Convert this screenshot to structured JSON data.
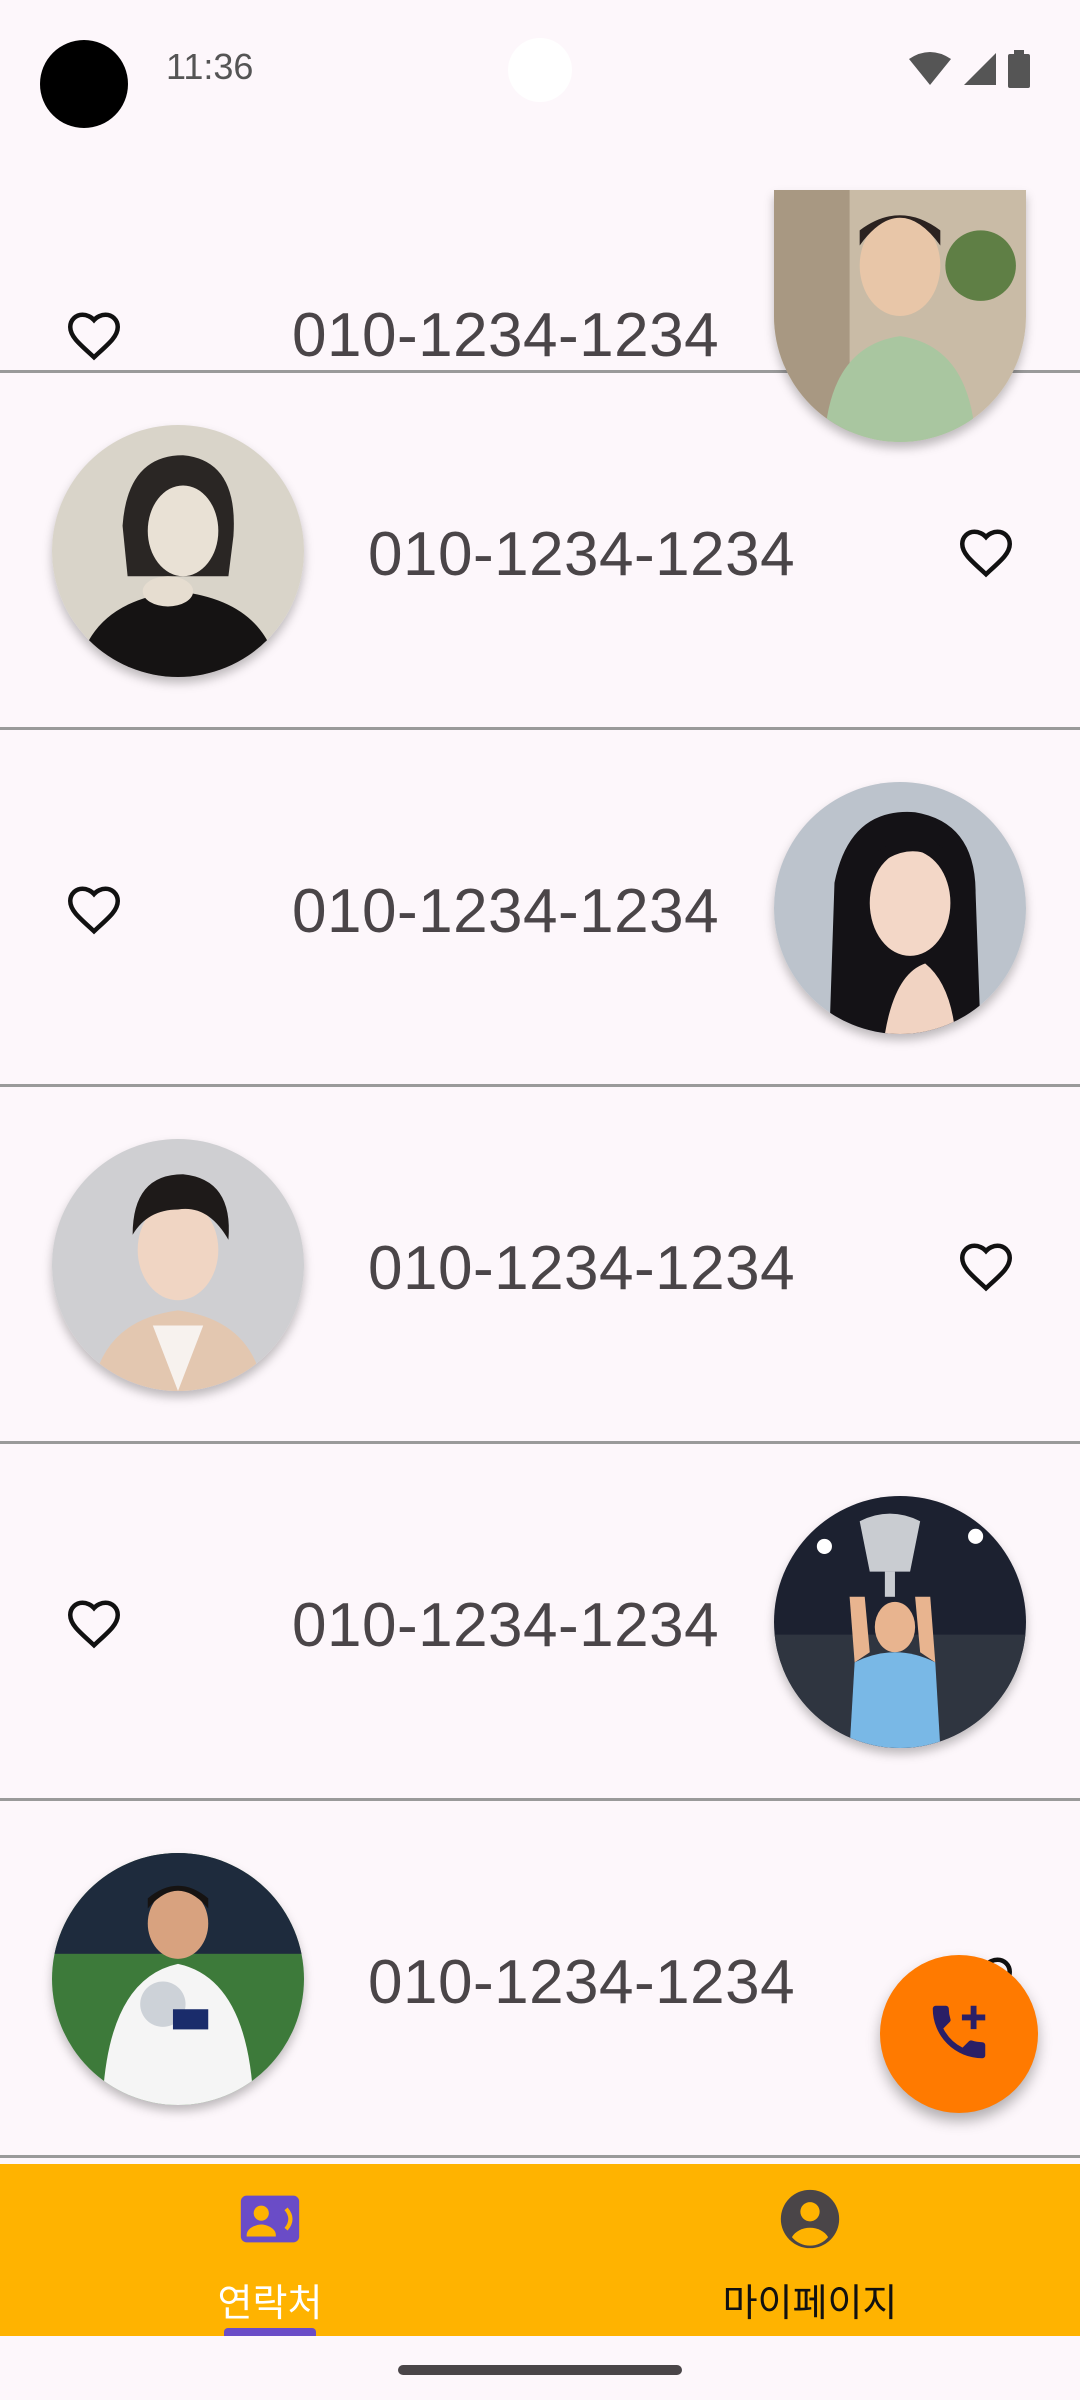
{
  "status_bar": {
    "time": "11:36"
  },
  "contacts": [
    {
      "phone": "010-1234-1234",
      "favorite": false,
      "avatar": "man-green-shirt-photo"
    },
    {
      "phone": "010-1234-1234",
      "favorite": false,
      "avatar": "woman-black-turtleneck-photo"
    },
    {
      "phone": "010-1234-1234",
      "favorite": false,
      "avatar": "woman-long-black-hair-photo"
    },
    {
      "phone": "010-1234-1234",
      "favorite": false,
      "avatar": "man-portrait-photo"
    },
    {
      "phone": "010-1234-1234",
      "favorite": false,
      "avatar": "player-holding-trophy-photo"
    },
    {
      "phone": "010-1234-1234",
      "favorite": false,
      "avatar": "player-with-award-photo"
    }
  ],
  "fab": {
    "icon": "add-call-icon"
  },
  "bottom_nav": {
    "items": [
      {
        "label": "연락처",
        "icon": "contacts-icon",
        "selected": true
      },
      {
        "label": "마이페이지",
        "icon": "account-circle-icon",
        "selected": false
      }
    ]
  },
  "colors": {
    "background": "#fdf7fb",
    "nav_background": "#ffb300",
    "fab": "#ff7a00",
    "nav_selected": "#6a4cc7",
    "selected_label": "#ffffff"
  }
}
